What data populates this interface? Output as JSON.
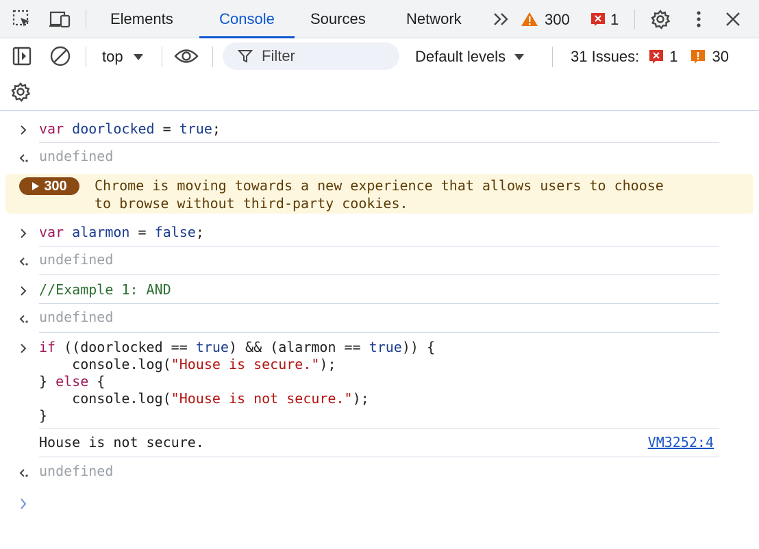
{
  "tabs": {
    "elements": "Elements",
    "console": "Console",
    "sources": "Sources",
    "network": "Network"
  },
  "status": {
    "warnings_count": "300",
    "errors_count": "1"
  },
  "toolbar": {
    "context": "top",
    "filter_placeholder": "Filter",
    "levels": "Default levels",
    "issues_label": "31 Issues:",
    "issues_errors": "1",
    "issues_warnings": "30"
  },
  "console": {
    "line1": {
      "kw": "var",
      "name": "doorlocked",
      "op": " = ",
      "value": "true",
      "end": ";"
    },
    "result1": "undefined",
    "warning": {
      "count": "300",
      "text": "Chrome is moving towards a new experience that allows users to choose\nto browse without third-party cookies."
    },
    "line2": {
      "kw": "var",
      "name": "alarmon",
      "op": " = ",
      "value": "false",
      "end": ";"
    },
    "result2": "undefined",
    "line3": "//Example 1: AND",
    "result3": "undefined",
    "block": {
      "if_kw": "if",
      "cond_a": " ((doorlocked == ",
      "cond_true1": "true",
      "cond_b": ") && (alarmon == ",
      "cond_true2": "true",
      "cond_c": ")) {",
      "log1_pre": "    console.log(",
      "log1_str": "\"House is secure.\"",
      "log_post": ");",
      "else_pre": "} ",
      "else_kw": "else",
      "else_post": " {",
      "log2_pre": "    console.log(",
      "log2_str": "\"House is not secure.\"",
      "close": "}"
    },
    "output": "House is not secure.",
    "output_source": "VM3252:4",
    "result4": "undefined"
  },
  "colors": {
    "accent": "#0b57d0",
    "warning_bg": "#fef7e0",
    "keyword": "#a0195a",
    "string": "#b31412"
  },
  "icons": {
    "inspect": "inspect-element-icon",
    "device": "device-toolbar-icon",
    "more_tabs": "more-tabs-icon",
    "warning": "warning-triangle-icon",
    "error": "error-icon",
    "settings": "gear-icon",
    "menu": "kebab-menu-icon",
    "close": "close-icon",
    "sidebar": "sidebar-toggle-icon",
    "clear": "clear-console-icon",
    "eye": "live-expression-icon",
    "filter": "filter-icon"
  }
}
